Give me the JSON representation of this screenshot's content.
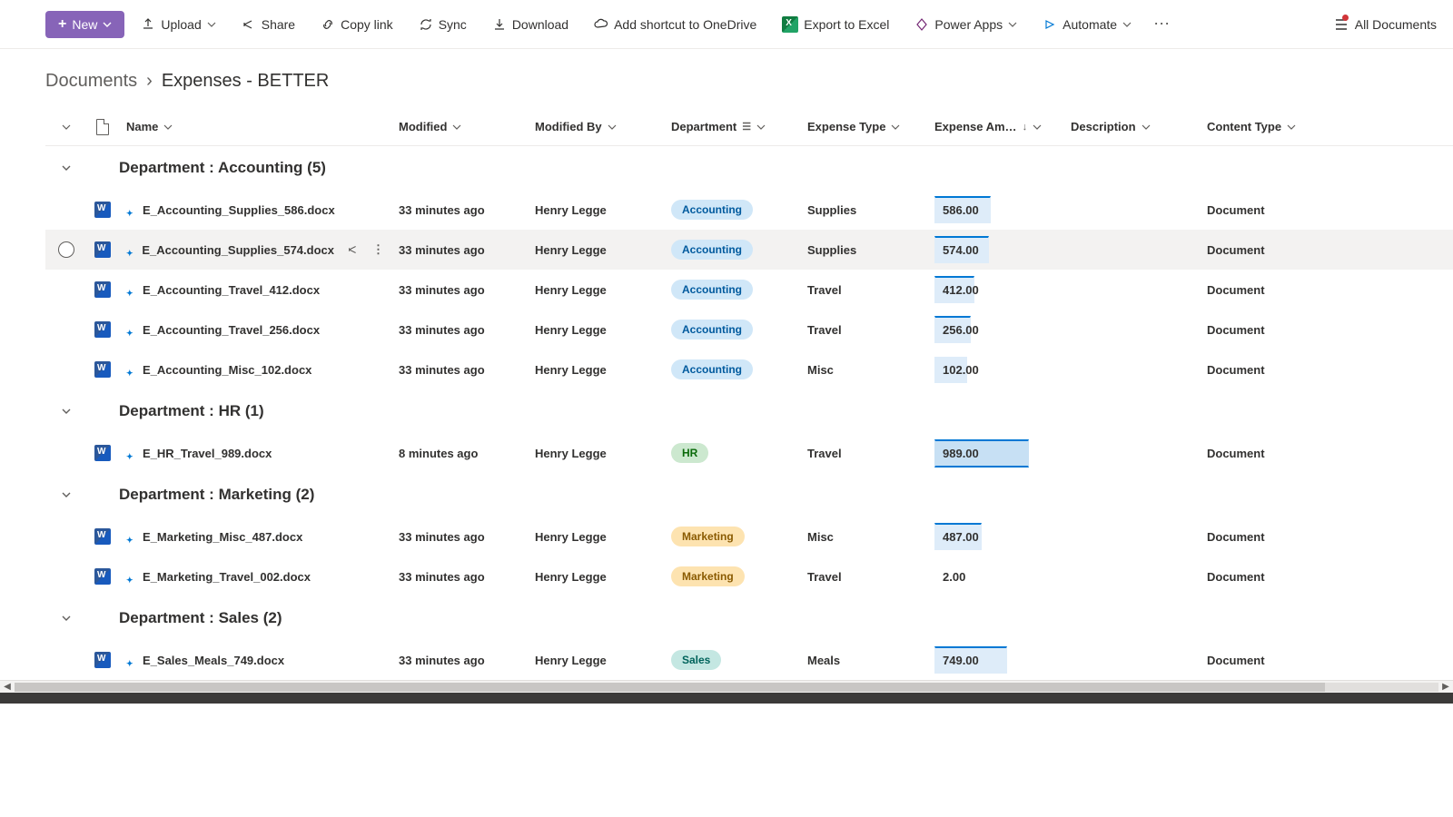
{
  "toolbar": {
    "new_label": "New",
    "upload_label": "Upload",
    "share_label": "Share",
    "copylink_label": "Copy link",
    "sync_label": "Sync",
    "download_label": "Download",
    "shortcut_label": "Add shortcut to OneDrive",
    "export_excel_label": "Export to Excel",
    "power_apps_label": "Power Apps",
    "automate_label": "Automate",
    "views_label": "All Documents"
  },
  "breadcrumb": {
    "parent": "Documents",
    "current": "Expenses - BETTER"
  },
  "columns": {
    "name": "Name",
    "modified": "Modified",
    "modified_by": "Modified By",
    "department": "Department",
    "expense_type": "Expense Type",
    "expense_amount": "Expense Am…",
    "description": "Description",
    "content_type": "Content Type"
  },
  "groups": [
    {
      "label": "Department : Accounting (5)",
      "items": [
        {
          "name": "E_Accounting_Supplies_586.docx",
          "modified": "33 minutes ago",
          "by": "Henry Legge",
          "dept": "Accounting",
          "dept_class": "accounting",
          "type": "Supplies",
          "amount": "586.00",
          "bar": "bar-586",
          "ctype": "Document",
          "hovered": false
        },
        {
          "name": "E_Accounting_Supplies_574.docx",
          "modified": "33 minutes ago",
          "by": "Henry Legge",
          "dept": "Accounting",
          "dept_class": "accounting",
          "type": "Supplies",
          "amount": "574.00",
          "bar": "bar-574",
          "ctype": "Document",
          "hovered": true
        },
        {
          "name": "E_Accounting_Travel_412.docx",
          "modified": "33 minutes ago",
          "by": "Henry Legge",
          "dept": "Accounting",
          "dept_class": "accounting",
          "type": "Travel",
          "amount": "412.00",
          "bar": "bar-412",
          "ctype": "Document",
          "hovered": false
        },
        {
          "name": "E_Accounting_Travel_256.docx",
          "modified": "33 minutes ago",
          "by": "Henry Legge",
          "dept": "Accounting",
          "dept_class": "accounting",
          "type": "Travel",
          "amount": "256.00",
          "bar": "bar-256",
          "ctype": "Document",
          "hovered": false
        },
        {
          "name": "E_Accounting_Misc_102.docx",
          "modified": "33 minutes ago",
          "by": "Henry Legge",
          "dept": "Accounting",
          "dept_class": "accounting",
          "type": "Misc",
          "amount": "102.00",
          "bar": "bar-102",
          "ctype": "Document",
          "hovered": false
        }
      ]
    },
    {
      "label": "Department : HR (1)",
      "items": [
        {
          "name": "E_HR_Travel_989.docx",
          "modified": "8 minutes ago",
          "by": "Henry Legge",
          "dept": "HR",
          "dept_class": "hr",
          "type": "Travel",
          "amount": "989.00",
          "bar": "bar-989",
          "ctype": "Document",
          "hovered": false
        }
      ]
    },
    {
      "label": "Department : Marketing (2)",
      "items": [
        {
          "name": "E_Marketing_Misc_487.docx",
          "modified": "33 minutes ago",
          "by": "Henry Legge",
          "dept": "Marketing",
          "dept_class": "marketing",
          "type": "Misc",
          "amount": "487.00",
          "bar": "bar-487",
          "ctype": "Document",
          "hovered": false
        },
        {
          "name": "E_Marketing_Travel_002.docx",
          "modified": "33 minutes ago",
          "by": "Henry Legge",
          "dept": "Marketing",
          "dept_class": "marketing",
          "type": "Travel",
          "amount": "2.00",
          "bar": "bar-2",
          "ctype": "Document",
          "hovered": false
        }
      ]
    },
    {
      "label": "Department : Sales (2)",
      "items": [
        {
          "name": "E_Sales_Meals_749.docx",
          "modified": "33 minutes ago",
          "by": "Henry Legge",
          "dept": "Sales",
          "dept_class": "sales",
          "type": "Meals",
          "amount": "749.00",
          "bar": "bar-749",
          "ctype": "Document",
          "hovered": false
        }
      ]
    }
  ]
}
